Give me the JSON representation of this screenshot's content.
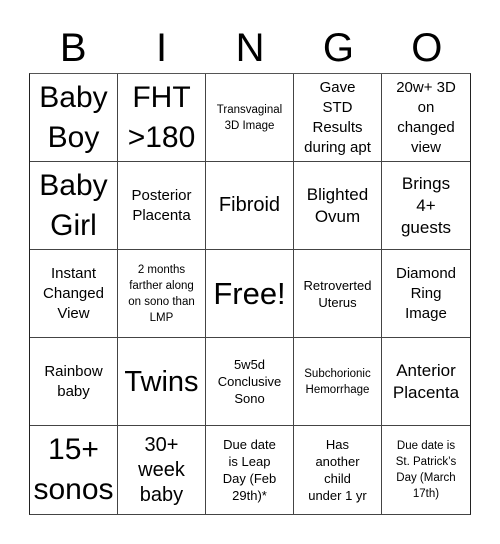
{
  "header": {
    "letters": [
      "B",
      "I",
      "N",
      "G",
      "O"
    ]
  },
  "board": {
    "cells": [
      {
        "text": "Baby\nBoy",
        "size": "xl"
      },
      {
        "text": "FHT\n>180",
        "size": "xl"
      },
      {
        "text": "Transvaginal\n3D Image",
        "size": "xxs"
      },
      {
        "text": "Gave\nSTD\nResults\nduring apt",
        "size": "sm"
      },
      {
        "text": "20w+ 3D\non\nchanged\nview",
        "size": "sm"
      },
      {
        "text": "Baby\nGirl",
        "size": "xl"
      },
      {
        "text": "Posterior\nPlacenta",
        "size": "sm"
      },
      {
        "text": "Fibroid",
        "size": "lg"
      },
      {
        "text": "Blighted\nOvum",
        "size": "md"
      },
      {
        "text": "Brings\n4+\nguests",
        "size": "md"
      },
      {
        "text": "Instant\nChanged\nView",
        "size": "sm"
      },
      {
        "text": "2 months\nfarther along\non sono than\nLMP",
        "size": "xxs"
      },
      {
        "text": "Free!",
        "size": "free"
      },
      {
        "text": "Retroverted\nUterus",
        "size": "xs"
      },
      {
        "text": "Diamond\nRing\nImage",
        "size": "sm"
      },
      {
        "text": "Rainbow\nbaby",
        "size": "sm"
      },
      {
        "text": "Twins",
        "size": "twins"
      },
      {
        "text": "5w5d\nConclusive\nSono",
        "size": "xs"
      },
      {
        "text": "Subchorionic\nHemorrhage",
        "size": "xxs"
      },
      {
        "text": "Anterior\nPlacenta",
        "size": "md"
      },
      {
        "text": "15+\nsonos",
        "size": "xl"
      },
      {
        "text": "30+\nweek\nbaby",
        "size": "lg"
      },
      {
        "text": "Due date\nis Leap\nDay (Feb\n29th)*",
        "size": "xs"
      },
      {
        "text": "Has\nanother\nchild\nunder 1 yr",
        "size": "xs"
      },
      {
        "text": "Due date is\nSt. Patrick’s\nDay (March\n17th)",
        "size": "xxs"
      }
    ]
  }
}
